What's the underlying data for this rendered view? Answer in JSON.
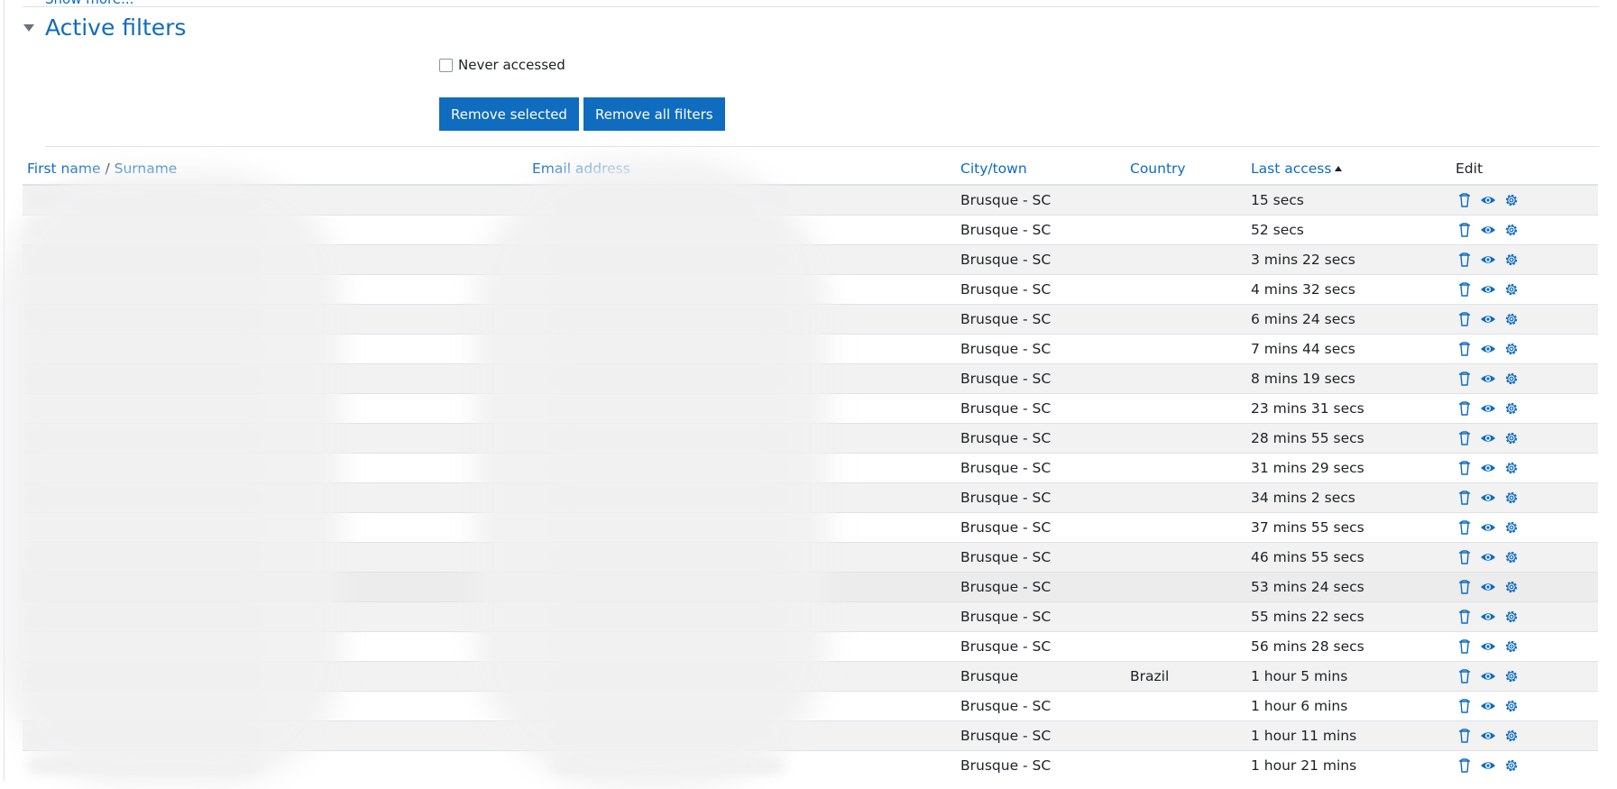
{
  "filters": {
    "show_more_label": "Show more...",
    "section_title": "Active filters",
    "never_accessed_label": "Never accessed",
    "never_accessed_checked": false,
    "remove_selected_label": "Remove selected",
    "remove_all_label": "Remove all filters"
  },
  "table": {
    "headers": {
      "first_name": "First name",
      "separator": "/",
      "surname": "Surname",
      "email": "Email address",
      "city": "City/town",
      "country": "Country",
      "last_access": "Last access",
      "edit": "Edit"
    },
    "sort": {
      "column": "last_access",
      "direction": "ascending"
    },
    "rows": [
      {
        "name": "",
        "email": "",
        "city": "Brusque - SC",
        "country": "",
        "last_access": "15 secs"
      },
      {
        "name": "",
        "email": "",
        "city": "Brusque - SC",
        "country": "",
        "last_access": "52 secs"
      },
      {
        "name": "",
        "email": "",
        "city": "Brusque - SC",
        "country": "",
        "last_access": "3 mins 22 secs"
      },
      {
        "name": "",
        "email": "",
        "city": "Brusque - SC",
        "country": "",
        "last_access": "4 mins 32 secs"
      },
      {
        "name": "",
        "email": "",
        "city": "Brusque - SC",
        "country": "",
        "last_access": "6 mins 24 secs"
      },
      {
        "name": "",
        "email": "",
        "city": "Brusque - SC",
        "country": "",
        "last_access": "7 mins 44 secs"
      },
      {
        "name": "",
        "email": "",
        "city": "Brusque - SC",
        "country": "",
        "last_access": "8 mins 19 secs"
      },
      {
        "name": "",
        "email": "",
        "city": "Brusque - SC",
        "country": "",
        "last_access": "23 mins 31 secs"
      },
      {
        "name": "",
        "email": "",
        "city": "Brusque - SC",
        "country": "",
        "last_access": "28 mins 55 secs"
      },
      {
        "name": "",
        "email": "",
        "city": "Brusque - SC",
        "country": "",
        "last_access": "31 mins 29 secs"
      },
      {
        "name": "",
        "email": "",
        "city": "Brusque - SC",
        "country": "",
        "last_access": "34 mins 2 secs"
      },
      {
        "name": "",
        "email": "",
        "city": "Brusque - SC",
        "country": "",
        "last_access": "37 mins 55 secs"
      },
      {
        "name": "",
        "email": "",
        "city": "Brusque - SC",
        "country": "",
        "last_access": "46 mins 55 secs"
      },
      {
        "name": "",
        "email": "",
        "city": "Brusque - SC",
        "country": "",
        "last_access": "53 mins 24 secs"
      },
      {
        "name": "",
        "email": "",
        "city": "Brusque - SC",
        "country": "",
        "last_access": "55 mins 22 secs"
      },
      {
        "name": "",
        "email": "",
        "city": "Brusque - SC",
        "country": "",
        "last_access": "56 mins 28 secs"
      },
      {
        "name": "",
        "email": "",
        "city": "Brusque",
        "country": "Brazil",
        "last_access": "1 hour 5 mins"
      },
      {
        "name": "",
        "email": "",
        "city": "Brusque - SC",
        "country": "",
        "last_access": "1 hour 6 mins"
      },
      {
        "name": "",
        "email": "",
        "city": "Brusque - SC",
        "country": "",
        "last_access": "1 hour 11 mins"
      },
      {
        "name": "",
        "email": "",
        "city": "Brusque - SC",
        "country": "",
        "last_access": "1 hour 21 mins"
      }
    ]
  },
  "icons": {
    "delete": "trash-icon",
    "view": "eye-icon",
    "settings": "gear-icon"
  },
  "colors": {
    "link": "#0f6cbf",
    "button_bg": "#0f6cbf",
    "button_text": "#ffffff",
    "row_stripe": "#f2f2f2",
    "border": "#dee2e6"
  }
}
